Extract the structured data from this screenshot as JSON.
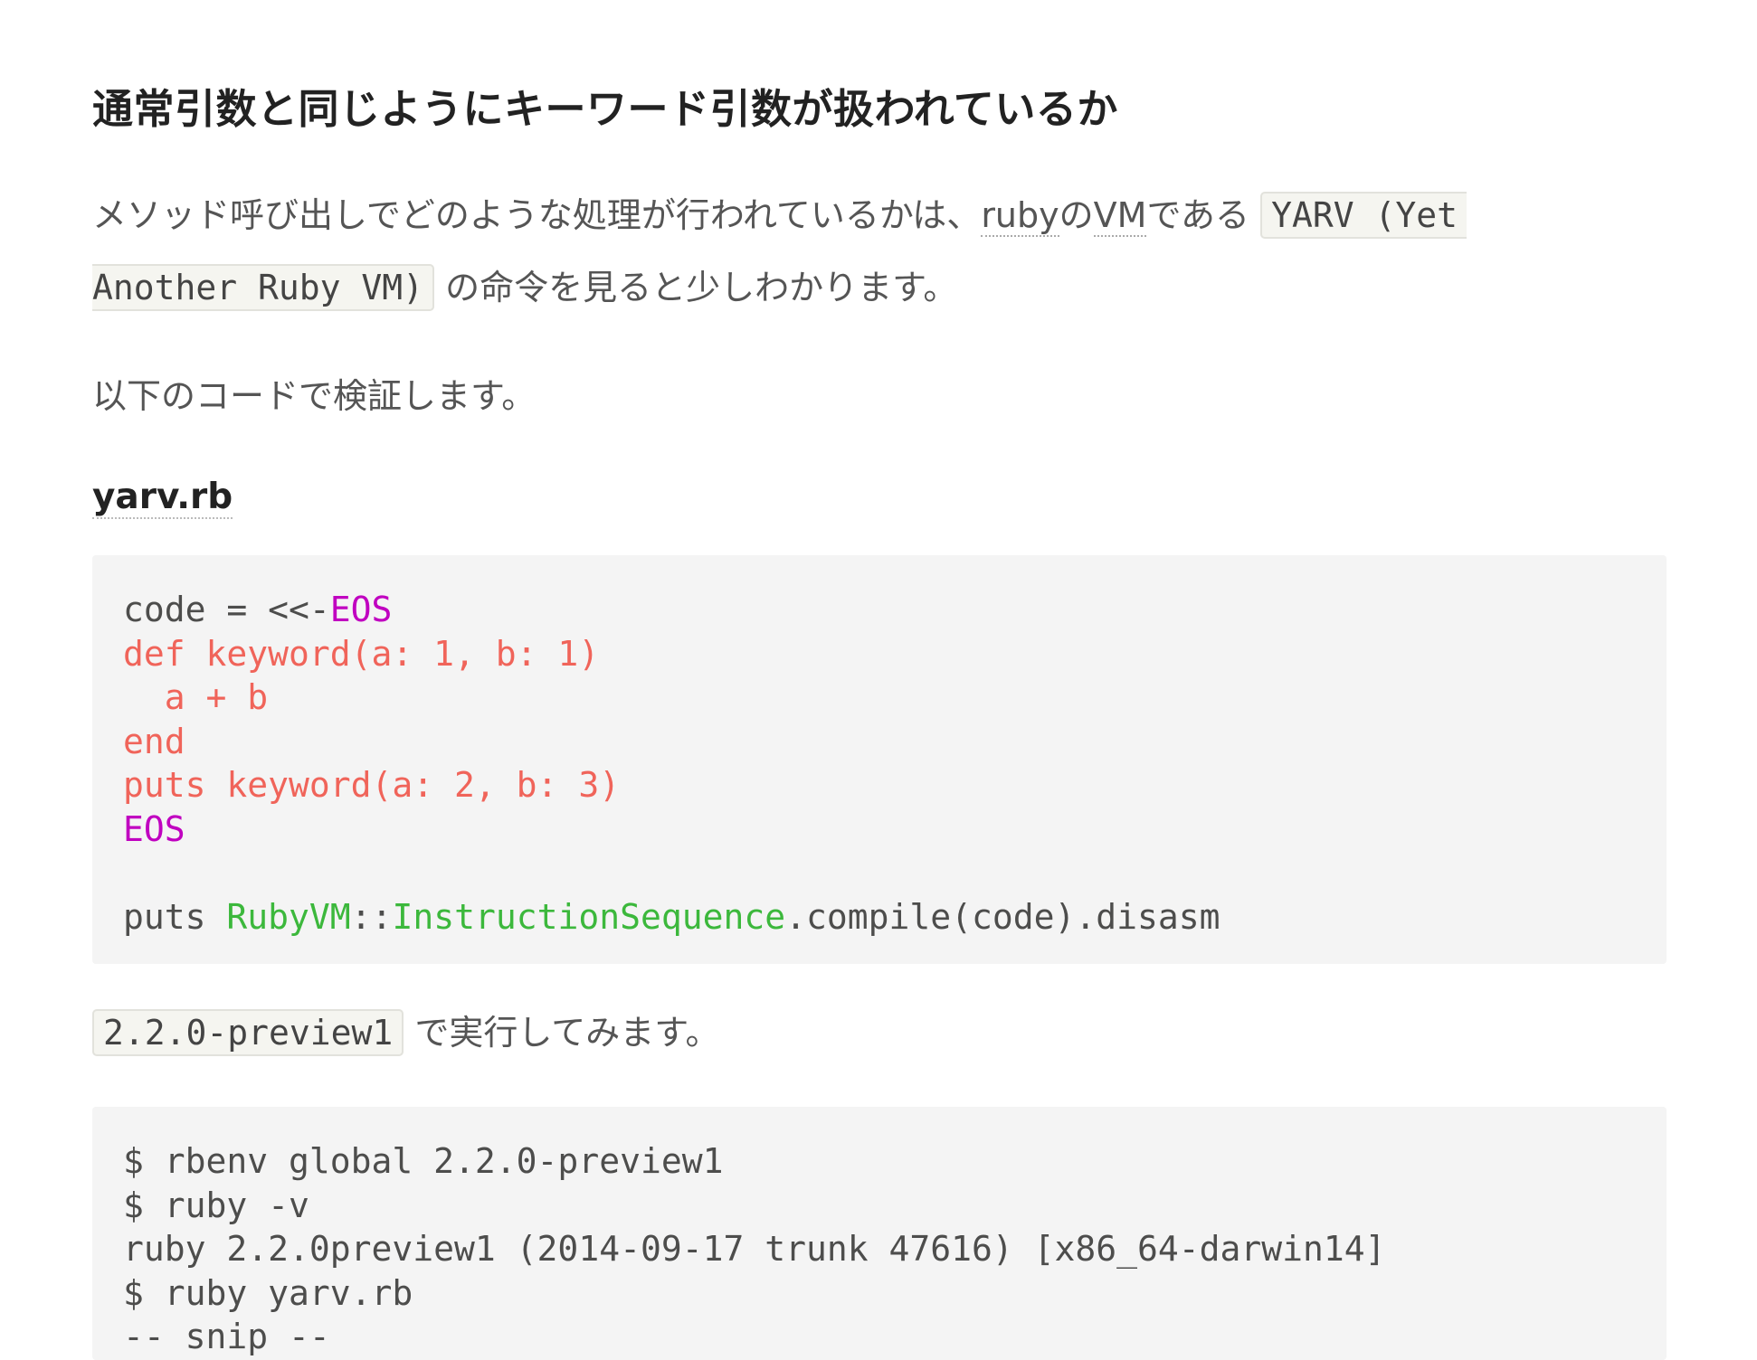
{
  "heading": "通常引数と同じようにキーワード引数が扱われているか",
  "paragraph1": {
    "text_before": "メソッド呼び出しでどのような処理が行われているかは、",
    "abbr_ruby": "ruby",
    "particle_no": "の",
    "abbr_vm": "VM",
    "text_dearu": "である",
    "code_yarv_part1": "YARV (Yet",
    "code_yarv_part2": "Another Ruby VM)",
    "text_after": "の命令を見ると少しわかります。"
  },
  "paragraph2": "以下のコードで検証します。",
  "file_name": "yarv.rb",
  "code_block_1": {
    "lines": [
      [
        {
          "t": "code = <<-",
          "c": "plain"
        },
        {
          "t": "EOS",
          "c": "heredoc"
        }
      ],
      [
        {
          "t": "def keyword(a: 1, b: 1)",
          "c": "string"
        }
      ],
      [
        {
          "t": "  a + b",
          "c": "string"
        }
      ],
      [
        {
          "t": "end",
          "c": "string"
        }
      ],
      [
        {
          "t": "puts keyword(a: 2, b: 3)",
          "c": "string"
        }
      ],
      [
        {
          "t": "EOS",
          "c": "heredoc"
        }
      ],
      [
        {
          "t": "",
          "c": "plain"
        }
      ],
      [
        {
          "t": "puts ",
          "c": "plain"
        },
        {
          "t": "RubyVM",
          "c": "class"
        },
        {
          "t": "::",
          "c": "plain"
        },
        {
          "t": "InstructionSequence",
          "c": "class"
        },
        {
          "t": ".compile(code).disasm",
          "c": "plain"
        }
      ]
    ]
  },
  "paragraph3": {
    "code_version": "2.2.0-preview1",
    "text": "で実行してみます。"
  },
  "code_block_2": {
    "lines": [
      [
        {
          "t": "$ rbenv global 2.2.0-preview1",
          "c": "plain"
        }
      ],
      [
        {
          "t": "$ ruby -v",
          "c": "plain"
        }
      ],
      [
        {
          "t": "ruby 2.2.0preview1 (2014-09-17 trunk 47616) [x86_64-darwin14]",
          "c": "plain"
        }
      ],
      [
        {
          "t": "$ ruby yarv.rb",
          "c": "plain"
        }
      ],
      [
        {
          "t": "-- snip --",
          "c": "plain"
        }
      ]
    ]
  },
  "colors": {
    "heredoc": "#c000c0",
    "string": "#f0645a",
    "class": "#3cb83c",
    "plain": "#4d4d4c",
    "code_background": "#f4f4f4"
  }
}
